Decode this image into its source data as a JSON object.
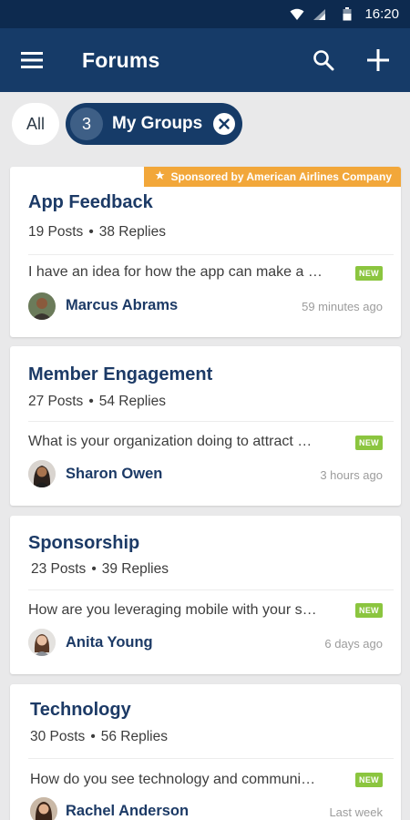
{
  "status_bar": {
    "time": "16:20"
  },
  "app_bar": {
    "title": "Forums",
    "menu_icon": "menu-icon",
    "search_icon": "search-icon",
    "add_icon": "plus-icon"
  },
  "filters": {
    "all_label": "All",
    "groups_count": "3",
    "groups_label": "My Groups"
  },
  "colors": {
    "primary": "#163b68",
    "status_bar": "#0d2a4f",
    "title_blue": "#1c3a66",
    "new_badge": "#8bc53f",
    "sponsor": "#f2a73a"
  },
  "forums": [
    {
      "title": "App Feedback",
      "posts": "19 Posts",
      "replies": "38 Replies",
      "sponsor": "Sponsored by American Airlines Company",
      "preview": "I have an idea for how the app can make a …",
      "badge": "NEW",
      "author": "Marcus Abrams",
      "time": "59 minutes ago"
    },
    {
      "title": "Member Engagement",
      "posts": "27 Posts",
      "replies": "54 Replies",
      "preview": "What is your organization doing to attract …",
      "badge": "NEW",
      "author": "Sharon Owen",
      "time": "3 hours ago"
    },
    {
      "title": "Sponsorship",
      "posts": "23 Posts",
      "replies": "39 Replies",
      "preview": "How are you leveraging mobile with your s…",
      "badge": "NEW",
      "author": "Anita Young",
      "time": "6 days ago"
    },
    {
      "title": "Technology",
      "posts": "30 Posts",
      "replies": "56 Replies",
      "preview": "How do you see technology and communi…",
      "badge": "NEW",
      "author": "Rachel Anderson",
      "time": "Last week"
    }
  ]
}
